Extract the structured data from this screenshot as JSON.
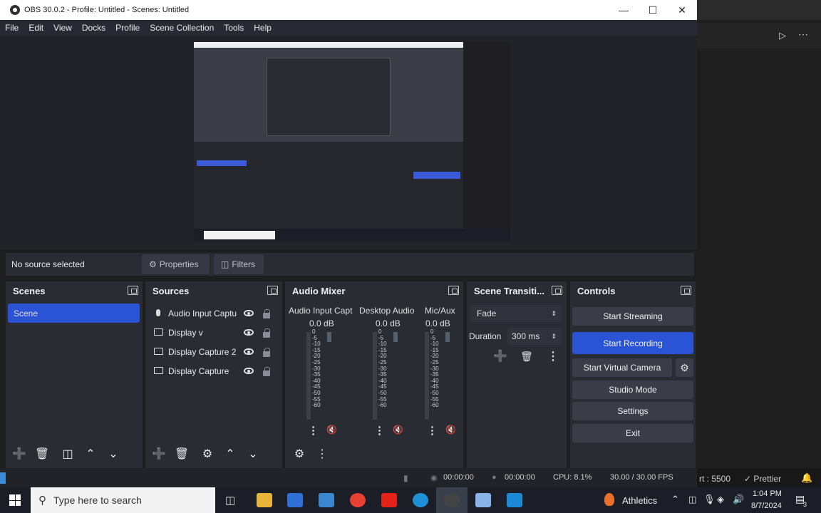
{
  "window": {
    "title": "OBS 30.0.2 - Profile: Untitled - Scenes: Untitled"
  },
  "menu": [
    "File",
    "Edit",
    "View",
    "Docks",
    "Profile",
    "Scene Collection",
    "Tools",
    "Help"
  ],
  "source_toolbar": {
    "status": "No source selected",
    "properties": "Properties",
    "filters": "Filters"
  },
  "docks": {
    "scenes": {
      "title": "Scenes",
      "items": [
        "Scene"
      ]
    },
    "sources": {
      "title": "Sources",
      "items": [
        "Audio Input Captu",
        "Display  v",
        "Display Capture 2",
        "Display Capture"
      ]
    },
    "mixer": {
      "title": "Audio Mixer",
      "channels": [
        {
          "name": "Audio Input Capt",
          "db": "0.0 dB"
        },
        {
          "name": "Desktop Audio",
          "db": "0.0 dB"
        },
        {
          "name": "Mic/Aux",
          "db": "0.0 dB"
        }
      ],
      "scale": [
        "0",
        "-5",
        "-10",
        "-15",
        "-20",
        "-25",
        "-30",
        "-35",
        "-40",
        "-45",
        "-50",
        "-55",
        "-60"
      ]
    },
    "transitions": {
      "title": "Scene Transiti...",
      "selected": "Fade",
      "duration_label": "Duration",
      "duration_value": "300 ms"
    },
    "controls": {
      "title": "Controls",
      "start_streaming": "Start Streaming",
      "start_recording": "Start Recording",
      "start_virtual_camera": "Start Virtual Camera",
      "studio_mode": "Studio Mode",
      "settings": "Settings",
      "exit": "Exit"
    }
  },
  "status": {
    "stream_time": "00:00:00",
    "rec_time": "00:00:00",
    "cpu": "CPU: 8.1%",
    "fps": "30.00 / 30.00 FPS"
  },
  "right_pane": {
    "status_port": "rt : 5500",
    "prettier": "Prettier"
  },
  "taskbar": {
    "search_placeholder": "Type here to search",
    "weather": "Athletics",
    "time": "1:04 PM",
    "date": "8/7/2024",
    "notif_count": "3"
  },
  "colors": {
    "accent": "#3a5ad9",
    "record_button": "#2b53d6",
    "meter_green": "#4b8b3b"
  }
}
